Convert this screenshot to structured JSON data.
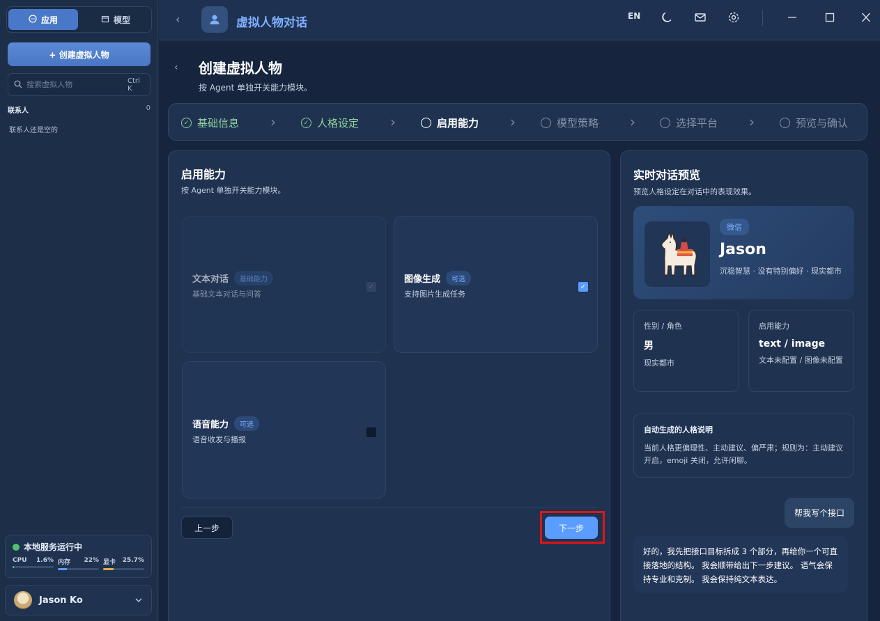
{
  "sidebar": {
    "tabs": [
      {
        "label": "应用"
      },
      {
        "label": "模型"
      }
    ],
    "create_button": "+ 创建虚拟人物",
    "search": {
      "placeholder": "搜索虚拟人物",
      "shortcut": "Ctrl K"
    },
    "contacts_label": "联系人",
    "contacts_count": "0",
    "empty_text": "联系人还是空的",
    "status": {
      "title": "本地服务运行中",
      "metrics": [
        {
          "label": "CPU",
          "value": "1.6%",
          "level": 0.016,
          "color": "#4fc36e"
        },
        {
          "label": "内存",
          "value": "22%",
          "level": 0.22,
          "color": "#5b9cff"
        },
        {
          "label": "显卡",
          "value": "25.7%",
          "level": 0.257,
          "color": "#e2a84b"
        }
      ]
    },
    "user_name": "Jason Ko"
  },
  "topbar": {
    "title": "虚拟人物对话",
    "lang": "EN"
  },
  "page": {
    "title": "创建虚拟人物",
    "subtitle": "按 Agent 单独开关能力模块。"
  },
  "steps": [
    {
      "label": "基础信息",
      "state": "done"
    },
    {
      "label": "人格设定",
      "state": "done"
    },
    {
      "label": "启用能力",
      "state": "current"
    },
    {
      "label": "模型策略",
      "state": "todo"
    },
    {
      "label": "选择平台",
      "state": "todo"
    },
    {
      "label": "预览与确认",
      "state": "todo"
    }
  ],
  "panel": {
    "title": "启用能力",
    "subtitle": "按 Agent 单独开关能力模块。",
    "cards": [
      {
        "name": "文本对话",
        "badge": "基础能力",
        "desc": "基础文本对话与问答",
        "checked": true,
        "disabled": true
      },
      {
        "name": "图像生成",
        "badge": "可选",
        "desc": "支持图片生成任务",
        "checked": true,
        "disabled": false
      },
      {
        "name": "语音能力",
        "badge": "可选",
        "desc": "语音收发与播报",
        "checked": false,
        "disabled": false
      }
    ],
    "prev": "上一步",
    "next": "下一步"
  },
  "preview": {
    "title": "实时对话预览",
    "subtitle": "预览人格设定在对话中的表现效果。",
    "platform": "微信",
    "name": "Jason",
    "desc": "沉稳智慧 · 没有特别偏好 · 现实都市",
    "gender_label": "性别 / 角色",
    "gender_value": "男",
    "gender_sub": "现实都市",
    "cap_label": "启用能力",
    "cap_value": "text / image",
    "cap_sub": "文本未配置 / 图像未配置",
    "auto_title": "自动生成的人格说明",
    "auto_desc": "当前人格更偏理性、主动建议、偏严肃；规则为：主动建议开启，emoji 关闭，允许闲聊。",
    "user_msg": "帮我写个接口",
    "bot_msg": "好的，我先把接口目标拆成 3 个部分，再给你一个可直接落地的结构。 我会顺带给出下一步建议。 语气会保持专业和克制。 我会保持纯文本表达。"
  }
}
